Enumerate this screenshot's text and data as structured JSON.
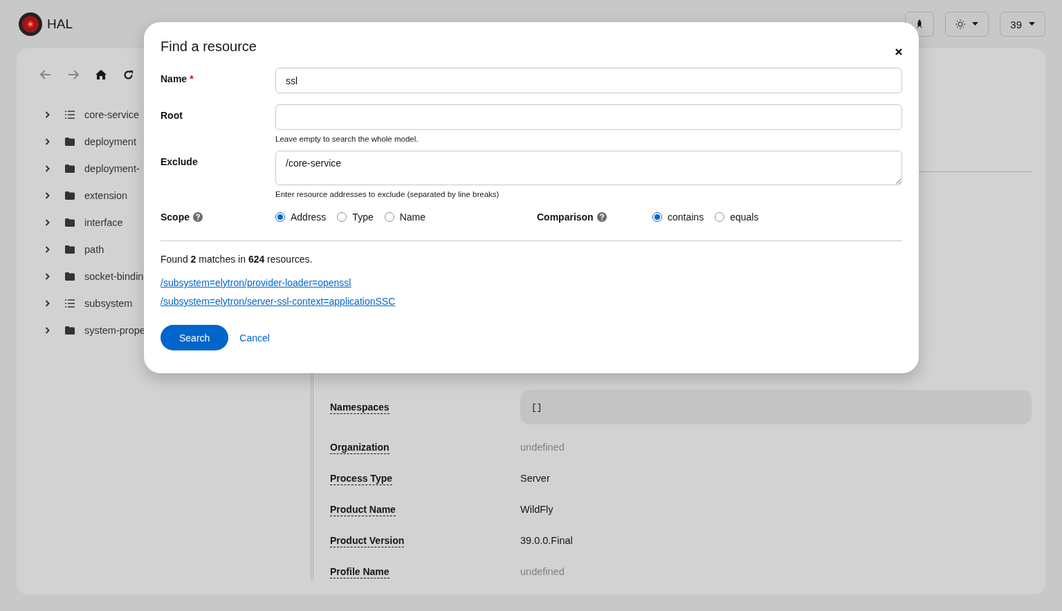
{
  "header": {
    "app_name": "HAL",
    "version_menu": "39"
  },
  "tree": [
    {
      "label": "core-service",
      "kind": "list",
      "expanded": false
    },
    {
      "label": "deployment",
      "kind": "folder",
      "expanded": false
    },
    {
      "label": "deployment-",
      "kind": "folder",
      "expanded": false
    },
    {
      "label": "extension",
      "kind": "folder",
      "expanded": false
    },
    {
      "label": "interface",
      "kind": "folder",
      "expanded": false
    },
    {
      "label": "path",
      "kind": "folder",
      "expanded": false
    },
    {
      "label": "socket-bindin",
      "kind": "folder",
      "expanded": false
    },
    {
      "label": "subsystem",
      "kind": "list",
      "expanded": false
    },
    {
      "label": "system-prope",
      "kind": "folder",
      "expanded": false
    }
  ],
  "details": [
    {
      "label": "Namespaces",
      "value": "[]",
      "kind": "code"
    },
    {
      "label": "Organization",
      "value": "undefined",
      "kind": "empty"
    },
    {
      "label": "Process Type",
      "value": "Server",
      "kind": "text"
    },
    {
      "label": "Product Name",
      "value": "WildFly",
      "kind": "text"
    },
    {
      "label": "Product Version",
      "value": "39.0.0.Final",
      "kind": "text"
    },
    {
      "label": "Profile Name",
      "value": "undefined",
      "kind": "empty"
    }
  ],
  "dialog": {
    "title": "Find a resource",
    "fields": [
      {
        "label": "Name",
        "required": true,
        "kind": "input",
        "value": "ssl"
      },
      {
        "label": "Root",
        "required": false,
        "kind": "input",
        "help": "Leave empty to search the whole model."
      },
      {
        "label": "Exclude",
        "required": false,
        "kind": "textarea",
        "value": "/core-service",
        "help": "Enter resource addresses to exclude (separated by line breaks)"
      }
    ],
    "scope": {
      "label": "Scope",
      "options": [
        {
          "label": "Address",
          "selected": true
        },
        {
          "label": "Type",
          "selected": false
        },
        {
          "label": "Name",
          "selected": false
        }
      ]
    },
    "comparison": {
      "label": "Comparison",
      "options": [
        {
          "label": "contains",
          "selected": true
        },
        {
          "label": "equals",
          "selected": false
        }
      ]
    },
    "result": "Found **2** matches in **624** resources.",
    "matches": [
      "/subsystem=elytron/provider-loader=openssl",
      "/subsystem=elytron/server-ssl-context=applicationSSC"
    ],
    "required_marker": "*",
    "primary_button": "Search",
    "secondary_button": "Cancel"
  }
}
